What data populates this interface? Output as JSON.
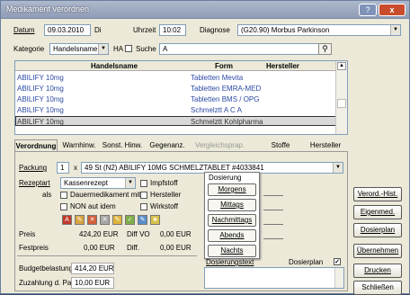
{
  "window": {
    "title": "Medikament verordnen",
    "help": "?",
    "close": "x"
  },
  "header": {
    "datum_label": "Datum",
    "datum_value": "09.03.2010",
    "day": "Di",
    "uhrzeit_label": "Uhrzeit",
    "uhrzeit_value": "10:02",
    "diagnose_label": "Diagnose",
    "diagnose_value": "(G20.90) Morbus Parkinson"
  },
  "search": {
    "kategorie_label": "Kategorie",
    "kategorie_value": "Handelsname",
    "ha_label": "HA",
    "suche_label": "Suche",
    "suche_value": "A"
  },
  "grid": {
    "columns": [
      "Handelsname",
      "Form",
      "Hersteller"
    ],
    "rows": [
      {
        "name": "ABILIFY 10mg",
        "form": "Tabletten Mevita",
        "hersteller": ""
      },
      {
        "name": "ABILIFY 10mg",
        "form": "Tabletten EMRA-MED",
        "hersteller": ""
      },
      {
        "name": "ABILIFY 10mg",
        "form": "Tabletten BMS / OPG",
        "hersteller": ""
      },
      {
        "name": "ABILIFY 10mg",
        "form": "Schmelztt A C A",
        "hersteller": ""
      },
      {
        "name": "ABILIFY 10mg",
        "form": "Schmelztt Kohlpharma",
        "hersteller": ""
      }
    ]
  },
  "tabs": [
    "Verordnung",
    "Warnhinw.",
    "Sonst. Hinw.",
    "Gegenanz.",
    "Vergleichsprap.",
    "Stoffe",
    "Hersteller"
  ],
  "form": {
    "packung_label": "Packung",
    "packung_qty": "1",
    "packung_x": "x",
    "packung_value": "49 St (N2) ABILIFY 10MG SCHMELZTABLET #4033841",
    "rezeptart_label": "Rezeptart",
    "rezeptart_value": "Kassenrezept",
    "impfstoff": "Impfstoff",
    "als": "als",
    "dauermedikament": "Dauermedikament mit",
    "hersteller_chk": "Hersteller",
    "non_aut_idem": "NON aut idem",
    "wirkstoff": "Wirkstoff",
    "preis_label": "Preis",
    "preis_value": "424,20 EUR",
    "diff_vo": "Diff VO",
    "diff_vo_value": "0,00 EUR",
    "festpreis_label": "Festpreis",
    "festpreis_value": "0,00 EUR",
    "diff": "Diff.",
    "diff_value": "0,00 EUR",
    "budget_label": "Budgetbelastung",
    "budget_value": "414,20 EUR",
    "zuzahlung_label": "Zuzahlung d. Pat.",
    "zuzahlung_value": "10,00 EUR",
    "dosiertext_label": "Dosierungstext",
    "dosierplan_label": "Dosierplan"
  },
  "dosierung": {
    "title": "Dosierung",
    "items": [
      "Morgens",
      "Mittags",
      "Nachmittags",
      "Abends",
      "Nachts"
    ]
  },
  "buttons": [
    "Verord.-Hist.",
    "Eigenmed.",
    "Dosierplan",
    "Übernehmen",
    "Drucken",
    "Schließen"
  ]
}
